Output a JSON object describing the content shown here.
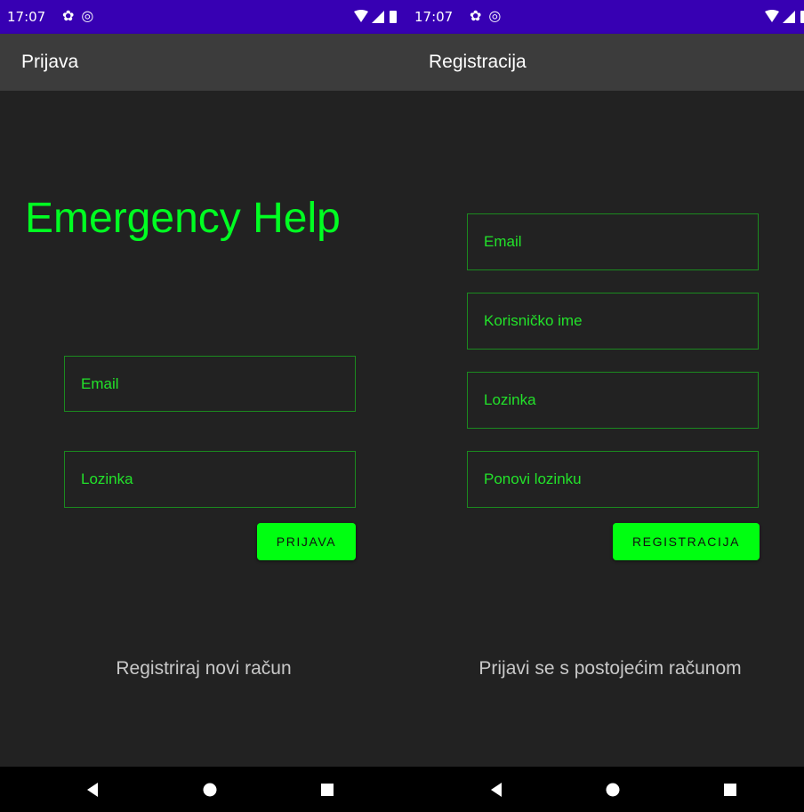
{
  "login_screen": {
    "status_bar": {
      "time": "17:07",
      "icons": [
        "gear-icon",
        "at-circle-icon",
        "wifi-icon",
        "signal-icon",
        "battery-icon"
      ]
    },
    "app_bar": {
      "title": "Prijava"
    },
    "app_heading": "Emergency Help",
    "fields": {
      "email_hint": "Email",
      "password_hint": "Lozinka"
    },
    "login_button": "PRIJAVA",
    "register_link": "Registriraj novi račun",
    "nav": [
      "back-icon",
      "home-icon",
      "recents-icon"
    ]
  },
  "register_screen": {
    "status_bar": {
      "time": "17:07",
      "icons": [
        "gear-icon",
        "at-circle-icon",
        "wifi-icon",
        "signal-icon",
        "battery-icon"
      ]
    },
    "app_bar": {
      "title": "Registracija"
    },
    "fields": {
      "email_hint": "Email",
      "username_hint": "Korisničko ime",
      "password_hint": "Lozinka",
      "repeat_password_hint": "Ponovi lozinku"
    },
    "register_button": "REGISTRACIJA",
    "login_link": "Prijavi se s postojećim računom",
    "nav": [
      "back-icon",
      "home-icon",
      "recents-icon"
    ]
  },
  "colors": {
    "status_bar": "#3700b3",
    "app_bar": "#3c3c3c",
    "background": "#222222",
    "accent_green": "#00ff11",
    "field_border": "#1b8a1f",
    "hint_text": "#22e22a",
    "link_text": "#c8c8c8",
    "nav_bar": "#000000"
  }
}
